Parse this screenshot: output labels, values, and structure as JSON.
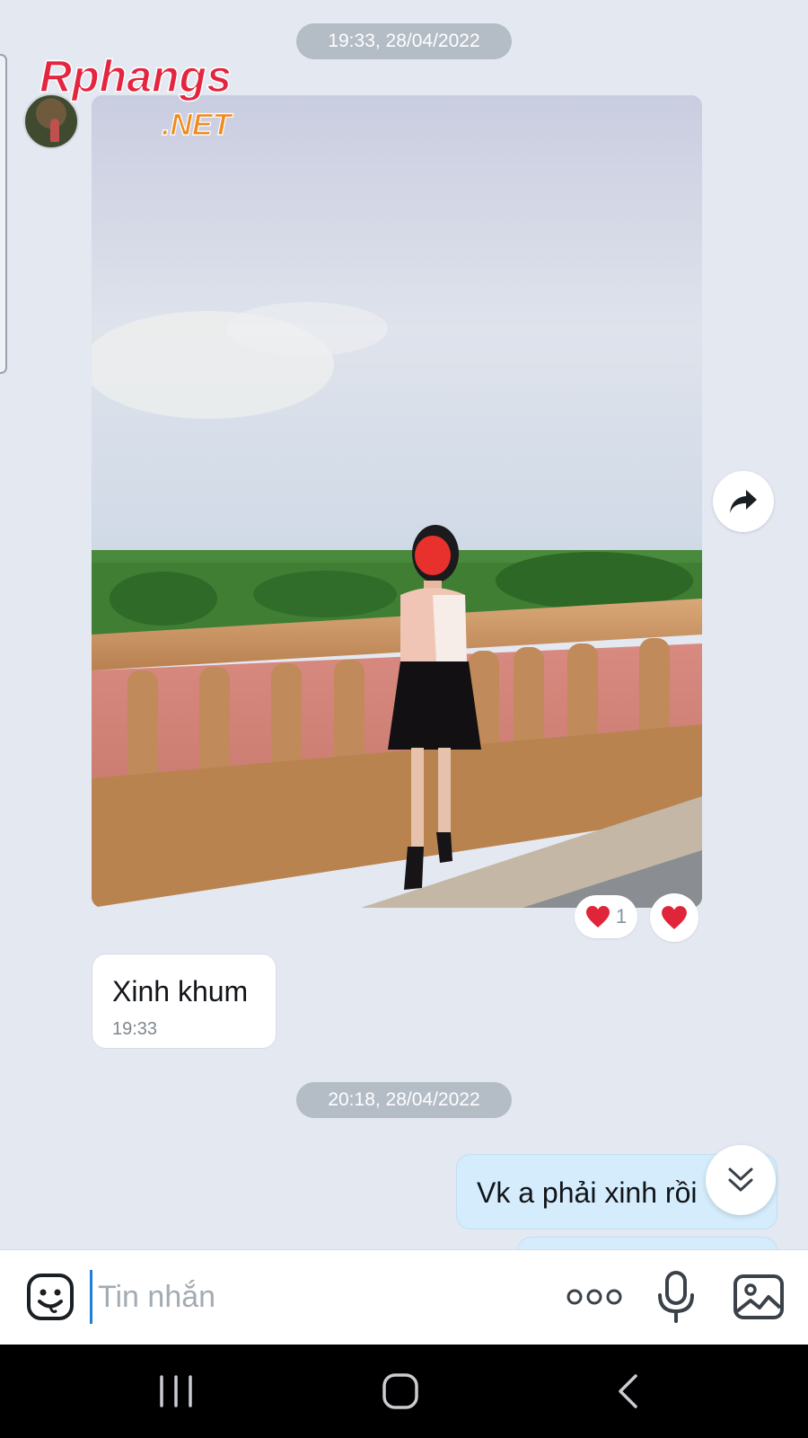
{
  "chat": {
    "timestamp_1": "19:33, 28/04/2022",
    "timestamp_2": "20:18, 28/04/2022",
    "photo_reaction": {
      "emoji": "❤️",
      "count": "1"
    },
    "messages": [
      {
        "direction": "incoming",
        "text": "Xinh khum",
        "time": "19:33"
      },
      {
        "direction": "outgoing",
        "text": "Vk a phải xinh rồi"
      }
    ]
  },
  "watermark": {
    "top": "Rphangs",
    "bottom": ".NET"
  },
  "composer": {
    "placeholder": "Tin nhắn"
  },
  "icons": {
    "share": "share-forward-icon",
    "scroll": "double-chevron-down-icon",
    "emoji": "sticker-face-icon",
    "more": "more-dots-icon",
    "mic": "microphone-icon",
    "image": "image-gallery-icon"
  },
  "colors": {
    "chat_background": "#e3e8f1",
    "outgoing_bubble": "#d4ecfb",
    "incoming_bubble": "#ffffff",
    "timestamp_pill": "#b4bcc6",
    "heart": "#e0243a",
    "caret": "#1f7fd8"
  }
}
